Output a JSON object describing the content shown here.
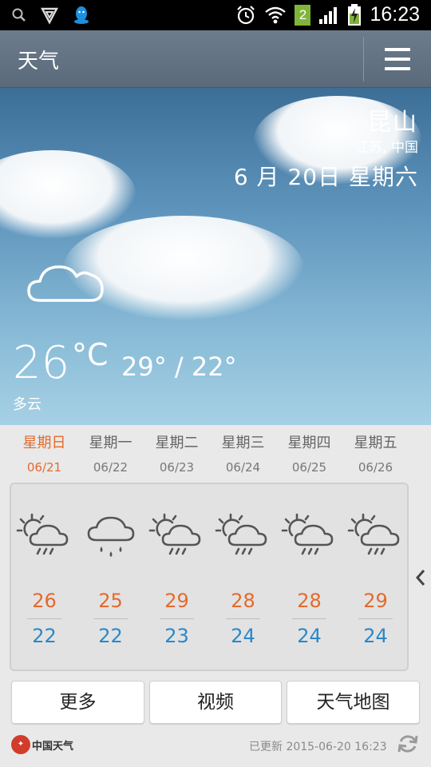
{
  "status_bar": {
    "time": "16:23",
    "sim_badge": "2",
    "icons": [
      "search-icon",
      "shield-icon",
      "qq-icon",
      "alarm-icon",
      "wifi-icon",
      "signal-icon",
      "battery-charging-icon"
    ]
  },
  "title_bar": {
    "title": "天气",
    "menu_icon": "menu-icon"
  },
  "hero": {
    "city": "昆山",
    "region": "江苏, 中国",
    "date": "6 月 20日 星期六",
    "temperature": "26",
    "unit": "°C",
    "range": "29° / 22°",
    "condition": "多云",
    "condition_icon": "cloud-icon"
  },
  "forecast": [
    {
      "day": "星期日",
      "date": "06/21",
      "high": "26",
      "low": "22",
      "icon": "sun-cloud-rain-icon",
      "today": true
    },
    {
      "day": "星期一",
      "date": "06/22",
      "high": "25",
      "low": "22",
      "icon": "cloud-rain-icon",
      "today": false
    },
    {
      "day": "星期二",
      "date": "06/23",
      "high": "29",
      "low": "23",
      "icon": "sun-cloud-rain-icon",
      "today": false
    },
    {
      "day": "星期三",
      "date": "06/24",
      "high": "28",
      "low": "24",
      "icon": "sun-cloud-rain-icon",
      "today": false
    },
    {
      "day": "星期四",
      "date": "06/25",
      "high": "28",
      "low": "24",
      "icon": "sun-cloud-rain-icon",
      "today": false
    },
    {
      "day": "星期五",
      "date": "06/26",
      "high": "29",
      "low": "24",
      "icon": "sun-cloud-rain-icon",
      "today": false
    }
  ],
  "buttons": {
    "more": "更多",
    "video": "视频",
    "map": "天气地图"
  },
  "footer": {
    "logo_text": "中国天气",
    "updated": "已更新 2015-06-20 16:23"
  },
  "colors": {
    "high_temp": "#e46a2d",
    "low_temp": "#2a88c9",
    "today": "#e46a2d",
    "title_bar": "#627282"
  }
}
